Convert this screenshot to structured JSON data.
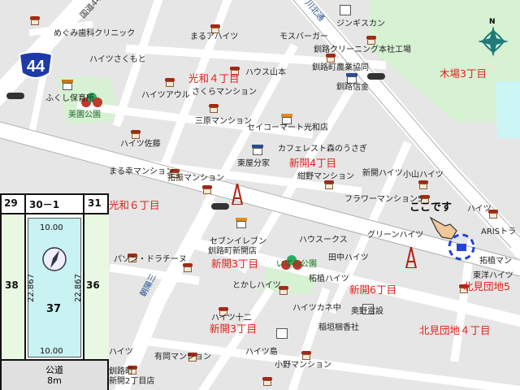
{
  "route_number": "44",
  "compass_label": "N",
  "here_label": "ここです",
  "area_labels": [
    {
      "text": "光和４丁目"
    },
    {
      "text": "木場3丁目"
    },
    {
      "text": "新開4丁目"
    },
    {
      "text": "光和６丁目"
    },
    {
      "text": "新開3丁目"
    },
    {
      "text": "新開6丁目"
    },
    {
      "text": "新開3丁目"
    },
    {
      "text": "北見団地5"
    },
    {
      "text": "北見団地４丁目"
    }
  ],
  "place_labels": [
    {
      "text": "めぐみ歯科クリニック"
    },
    {
      "text": "まるアハイツ"
    },
    {
      "text": "モスバーガー"
    },
    {
      "text": "ジンギスカン"
    },
    {
      "text": "釧路クリーニング本社工場"
    },
    {
      "text": "釧路町農業協同"
    },
    {
      "text": "ハイツさくもと"
    },
    {
      "text": "ハウス山本"
    },
    {
      "text": "釧路信金"
    },
    {
      "text": "ふくし保育所"
    },
    {
      "text": "ハイツアウル"
    },
    {
      "text": "さくらマンション"
    },
    {
      "text": "三原マンション"
    },
    {
      "text": "セイコーマート光和店"
    },
    {
      "text": "ハイツ佐藤"
    },
    {
      "text": "カフェレスト森のうさぎ"
    },
    {
      "text": "東屋分家"
    },
    {
      "text": "まる幸マンション"
    },
    {
      "text": "拓振マンション"
    },
    {
      "text": "紺野マンション"
    },
    {
      "text": "新開ハイツ"
    },
    {
      "text": "小山ハイツ"
    },
    {
      "text": "フラワーマンション5"
    },
    {
      "text": "セブンイレブン"
    },
    {
      "text": "釧路町新開店"
    },
    {
      "text": "ハウスークス"
    },
    {
      "text": "ハイツ"
    },
    {
      "text": "ARISトラ"
    },
    {
      "text": "グリーンハイツ"
    },
    {
      "text": "パソン・ドラチーヌ"
    },
    {
      "text": "田中ハイツ"
    },
    {
      "text": "拓植マン"
    },
    {
      "text": "とかしハイツ"
    },
    {
      "text": "柘植ハイツ"
    },
    {
      "text": "東洋ハイツ"
    },
    {
      "text": "ハイツカネ中"
    },
    {
      "text": "奥野電設"
    },
    {
      "text": "ハイツ十二"
    },
    {
      "text": "稲垣梱香社"
    },
    {
      "text": "ハイツ島"
    },
    {
      "text": "有岡マンション"
    },
    {
      "text": "小野マンション"
    },
    {
      "text": "ハイツ"
    },
    {
      "text": "釧路町"
    },
    {
      "text": "新開2丁目店"
    }
  ],
  "park_labels": [
    {
      "text": "美園公園"
    },
    {
      "text": "いずみ公園"
    }
  ],
  "road_labels": [
    {
      "text": "川北通"
    },
    {
      "text": "国道44号"
    },
    {
      "text": "朝陽三"
    }
  ],
  "lot_plan": {
    "top_numbers": [
      "29",
      "30－1",
      "31"
    ],
    "left_number": "38",
    "right_number": "36",
    "center_number": "37",
    "top_dim": "10.00",
    "bottom_dim": "10.00",
    "left_dim": "22.867",
    "right_dim": "22.867",
    "road_name": "公道",
    "road_width": "8m",
    "colors": {
      "lot_fill": "#c9f2f2",
      "frame": "#111111",
      "side_strip": "#e8f8e2"
    }
  },
  "colors": {
    "background": "#e6e6e6",
    "road": "#ffffff",
    "green_area": "#d6f0d2",
    "area_text": "#e0201c",
    "route_shield": "#1e3aa8",
    "pointer": "#2244dd"
  }
}
